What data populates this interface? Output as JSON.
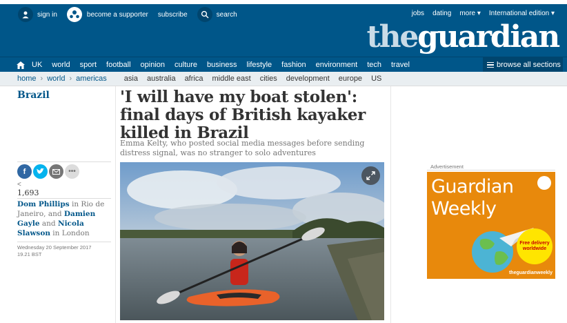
{
  "top": {
    "sign_in": "sign in",
    "supporter": "become a supporter",
    "subscribe": "subscribe",
    "search": "search",
    "right_links": [
      "jobs",
      "dating",
      "more ▾",
      "International edition ▾"
    ],
    "logo_the": "the",
    "logo_guardian": "guardian"
  },
  "nav": {
    "items": [
      "UK",
      "world",
      "sport",
      "football",
      "opinion",
      "culture",
      "business",
      "lifestyle",
      "fashion",
      "environment",
      "tech",
      "travel"
    ],
    "browse": "browse all sections"
  },
  "subnav": {
    "breadcrumbs": [
      "home",
      "world",
      "americas"
    ],
    "items": [
      "asia",
      "australia",
      "africa",
      "middle east",
      "cities",
      "development",
      "europe",
      "US"
    ]
  },
  "article": {
    "section": "Brazil",
    "headline": "'I will have my boat stolen': final days of British kayaker killed in Brazil",
    "standfirst": "Emma Kelty, who posted social media messages before sending distress signal, was no stranger to solo adventures",
    "share_count_icon": "<",
    "share_count": "1,693",
    "byline": {
      "author1": "Dom Phillips",
      "in1": " in Rio de Janeiro, and ",
      "author2": "Damien Gayle",
      "and": " and ",
      "author3": "Nicola Slawson",
      "in2": " in London"
    },
    "date": "Wednesday 20 September 2017",
    "time": "19.21 BST"
  },
  "ad": {
    "label": "Advertisement",
    "title": "Guardian Weekly",
    "badge": "Free delivery worldwide",
    "brand": "theguardianweekly"
  },
  "colors": {
    "brand_blue": "#005689",
    "dark_blue": "#00456e",
    "ad_orange": "#e8890c"
  }
}
